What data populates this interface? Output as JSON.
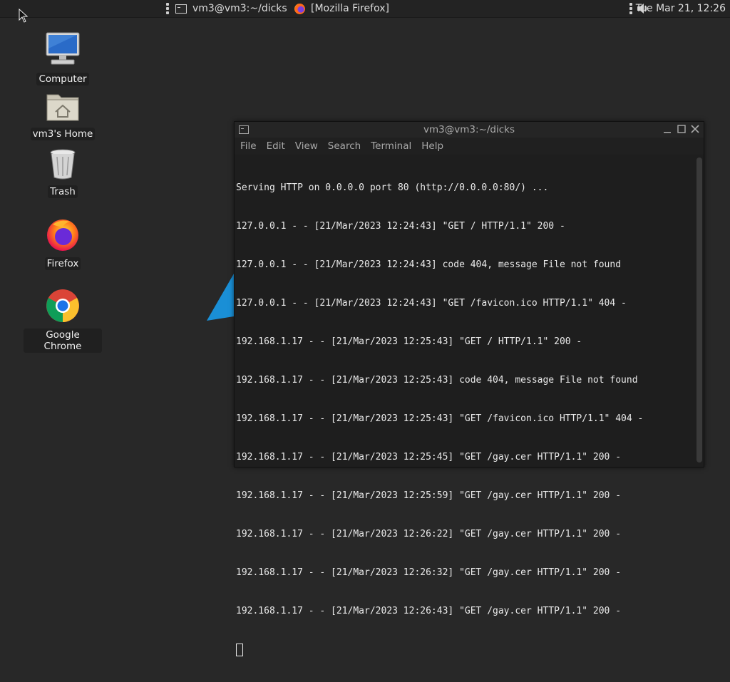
{
  "panel": {
    "tasks": [
      {
        "label": "vm3@vm3:~/dicks"
      },
      {
        "label": "[Mozilla Firefox]"
      }
    ],
    "clock": "Tue Mar 21, 12:26"
  },
  "desktop": {
    "icons": [
      {
        "label": "Computer",
        "icon": "computer-icon"
      },
      {
        "label": "vm3's Home",
        "icon": "home-folder-icon"
      },
      {
        "label": "Trash",
        "icon": "trash-icon"
      },
      {
        "label": "Firefox",
        "icon": "firefox-icon"
      },
      {
        "label": "Google Chrome",
        "icon": "chrome-icon"
      }
    ]
  },
  "terminal": {
    "title": "vm3@vm3:~/dicks",
    "menu": [
      "File",
      "Edit",
      "View",
      "Search",
      "Terminal",
      "Help"
    ],
    "lines": [
      "Serving HTTP on 0.0.0.0 port 80 (http://0.0.0.0:80/) ...",
      "127.0.0.1 - - [21/Mar/2023 12:24:43] \"GET / HTTP/1.1\" 200 -",
      "127.0.0.1 - - [21/Mar/2023 12:24:43] code 404, message File not found",
      "127.0.0.1 - - [21/Mar/2023 12:24:43] \"GET /favicon.ico HTTP/1.1\" 404 -",
      "192.168.1.17 - - [21/Mar/2023 12:25:43] \"GET / HTTP/1.1\" 200 -",
      "192.168.1.17 - - [21/Mar/2023 12:25:43] code 404, message File not found",
      "192.168.1.17 - - [21/Mar/2023 12:25:43] \"GET /favicon.ico HTTP/1.1\" 404 -",
      "192.168.1.17 - - [21/Mar/2023 12:25:45] \"GET /gay.cer HTTP/1.1\" 200 -",
      "192.168.1.17 - - [21/Mar/2023 12:25:59] \"GET /gay.cer HTTP/1.1\" 200 -",
      "192.168.1.17 - - [21/Mar/2023 12:26:22] \"GET /gay.cer HTTP/1.1\" 200 -",
      "192.168.1.17 - - [21/Mar/2023 12:26:32] \"GET /gay.cer HTTP/1.1\" 200 -",
      "192.168.1.17 - - [21/Mar/2023 12:26:43] \"GET /gay.cer HTTP/1.1\" 200 -"
    ]
  },
  "colors": {
    "desktop_bg": "#282828",
    "terminal_bg": "#1e1e1e",
    "accent_blue": "#1a8fd6"
  }
}
